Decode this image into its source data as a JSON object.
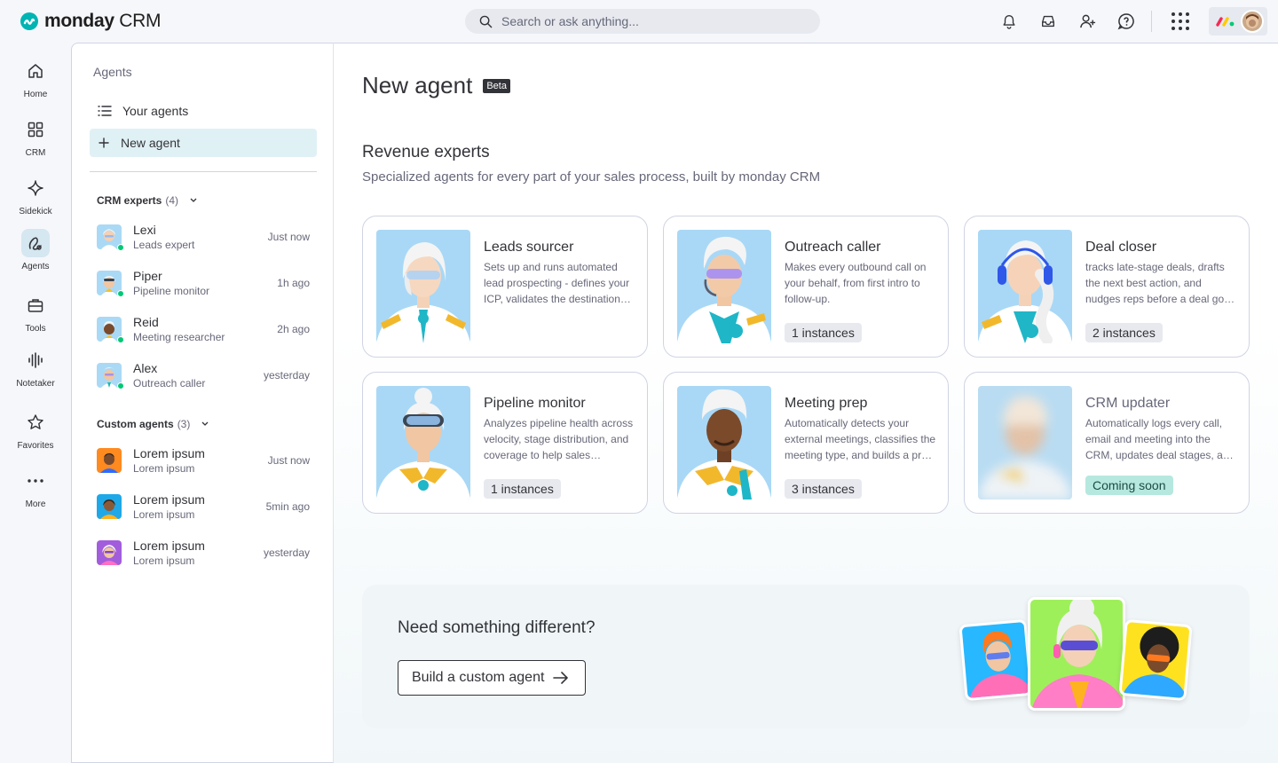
{
  "app": {
    "logo_word": "monday",
    "logo_suffix": "CRM",
    "search_placeholder": "Search or ask anything..."
  },
  "topbar": {
    "icons": [
      "bell-icon",
      "inbox-icon",
      "invite-user-icon",
      "help-icon",
      "apps-grid-icon"
    ]
  },
  "rail": {
    "items": [
      {
        "label": "Home",
        "icon": "home-icon"
      },
      {
        "label": "CRM",
        "icon": "grid-icon"
      },
      {
        "label": "Sidekick",
        "icon": "sparkle-icon"
      },
      {
        "label": "Agents",
        "icon": "agent-icon"
      },
      {
        "label": "Tools",
        "icon": "briefcase-icon"
      },
      {
        "label": "Notetaker",
        "icon": "waveform-icon"
      },
      {
        "label": "Favorites",
        "icon": "star-icon"
      },
      {
        "label": "More",
        "icon": "more-icon"
      }
    ]
  },
  "agents_panel": {
    "title": "Agents",
    "nav": [
      {
        "label": "Your agents",
        "icon": "list-icon"
      },
      {
        "label": "New agent",
        "icon": "plus-icon"
      }
    ],
    "crm_section": {
      "label": "CRM experts",
      "count": "(4)"
    },
    "crm_agents": [
      {
        "name": "Lexi",
        "role": "Leads expert",
        "time": "Just now"
      },
      {
        "name": "Piper",
        "role": "Pipeline monitor",
        "time": "1h ago"
      },
      {
        "name": "Reid",
        "role": "Meeting researcher",
        "time": "2h ago"
      },
      {
        "name": "Alex",
        "role": "Outreach caller",
        "time": "yesterday"
      }
    ],
    "custom_section": {
      "label": "Custom agents",
      "count": "(3)"
    },
    "custom_agents": [
      {
        "name": "Lorem ipsum",
        "role": "Lorem ipsum",
        "time": "Just now"
      },
      {
        "name": "Lorem ipsum",
        "role": "Lorem ipsum",
        "time": "5min ago"
      },
      {
        "name": "Lorem ipsum",
        "role": "Lorem ipsum",
        "time": "yesterday"
      }
    ]
  },
  "main": {
    "title": "New agent",
    "beta": "Beta",
    "section_title": "Revenue experts",
    "section_subtitle": "Specialized agents for every part of your sales process, built by monday CRM",
    "cards": [
      {
        "title": "Leads sourcer",
        "desc": "Sets up and runs automated lead prospecting - defines your ICP, validates the destination board, and fills it with leads",
        "badge": ""
      },
      {
        "title": "Outreach caller",
        "desc": "Makes every outbound call on your behalf, from first intro to follow-up.",
        "badge": "1 instances"
      },
      {
        "title": "Deal closer",
        "desc": "tracks late-stage deals, drafts the next best action, and nudges reps before a deal goes cold",
        "badge": "2 instances"
      },
      {
        "title": "Pipeline monitor",
        "desc": "Analyzes pipeline health across velocity, stage distribution, and coverage to help sales managers act early",
        "badge": "1 instances"
      },
      {
        "title": "Meeting prep",
        "desc": "Automatically detects your external meetings, classifies the meeting type, and builds a prep brief",
        "badge": "3 instances"
      },
      {
        "title": "CRM updater",
        "desc": "Automatically logs every call, email and meeting into the CRM, updates deal stages, and more",
        "badge": "Coming soon"
      }
    ],
    "custom": {
      "title": "Need something different?",
      "button": "Build a custom agent"
    }
  },
  "colors": {
    "brand_blue": "#0073ea",
    "online": "#00c875",
    "coming_soon": "#b6e8df",
    "selected_nav": "#e0f1f5"
  }
}
